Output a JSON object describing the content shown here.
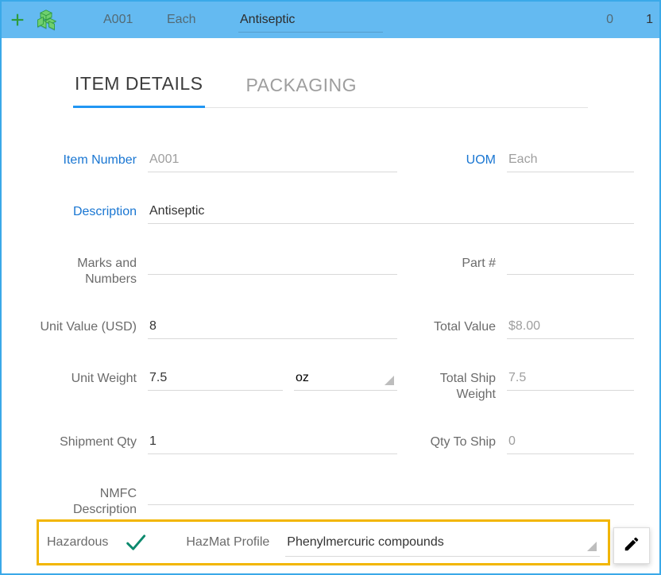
{
  "header": {
    "item_code": "A001",
    "uom": "Each",
    "description": "Antiseptic",
    "num1": "0",
    "num2": "1"
  },
  "tabs": {
    "t0": "ITEM DETAILS",
    "t1": "PACKAGING"
  },
  "labels": {
    "item_number": "Item Number",
    "uom": "UOM",
    "description": "Description",
    "marks": "Marks and Numbers",
    "part": "Part #",
    "unit_value": "Unit Value (USD)",
    "total_value": "Total Value",
    "unit_weight": "Unit Weight",
    "total_ship_weight": "Total Ship Weight",
    "shipment_qty": "Shipment Qty",
    "qty_to_ship": "Qty To Ship",
    "nmfc": "NMFC Description",
    "hazardous": "Hazardous",
    "hazmat_profile": "HazMat Profile"
  },
  "values": {
    "item_number": "A001",
    "uom": "Each",
    "description": "Antiseptic",
    "marks": "",
    "part": "",
    "unit_value": "8",
    "total_value": "$8.00",
    "unit_weight": "7.5",
    "unit_weight_unit": "oz",
    "total_ship_weight": "7.5",
    "shipment_qty": "1",
    "qty_to_ship": "0",
    "nmfc": "",
    "hazmat_profile": "Phenylmercuric compounds"
  }
}
